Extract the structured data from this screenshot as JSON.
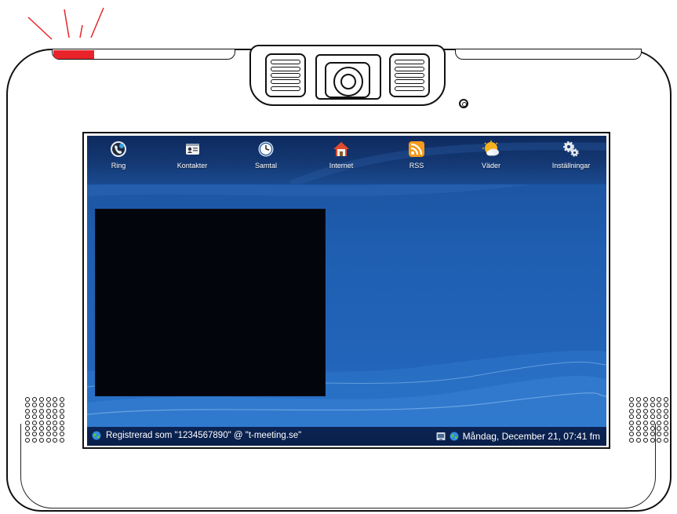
{
  "toolbar": {
    "items": [
      {
        "label": "Ring",
        "icon": "phone-icon"
      },
      {
        "label": "Kontakter",
        "icon": "contacts-icon"
      },
      {
        "label": "Samtal",
        "icon": "clock-icon"
      },
      {
        "label": "Internet",
        "icon": "home-icon"
      },
      {
        "label": "RSS",
        "icon": "rss-icon"
      },
      {
        "label": "Väder",
        "icon": "weather-icon"
      },
      {
        "label": "Inställningar",
        "icon": "gears-icon"
      }
    ]
  },
  "status": {
    "registration": "Registrerad som \"1234567890\" @ \"t-meeting.se\"",
    "datetime": "Måndag, December 21, 07:41 fm"
  },
  "colors": {
    "led": "#e8242a",
    "desktop": "#1f5fb2",
    "toolbar": "#143873",
    "statusbar": "#0b2454",
    "video": "#03050c"
  }
}
